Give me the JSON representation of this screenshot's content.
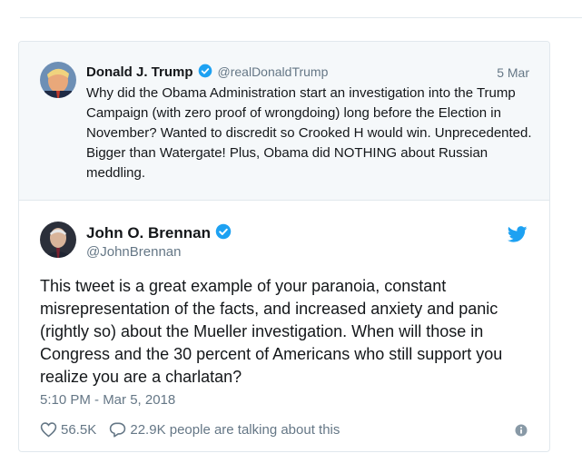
{
  "quoted": {
    "name": "Donald J. Trump",
    "handle": "@realDonaldTrump",
    "date": "5 Mar",
    "text": "Why did the Obama Administration start an investigation into the Trump Campaign (with zero proof of wrongdoing) long before the Election in November? Wanted to discredit so Crooked H would win. Unprecedented. Bigger than Watergate! Plus, Obama did NOTHING about Russian meddling.",
    "verified_icon": "verified-badge-icon",
    "avatar_icon": "avatar"
  },
  "main": {
    "name": "John O. Brennan",
    "handle": "@JohnBrennan",
    "text": "This tweet is a great example of your paranoia, constant misrepresentation of the facts, and increased anxiety and panic (rightly so) about the Mueller investigation. When will those in Congress and the 30 percent of Americans who still support you realize you are a charlatan?",
    "timestamp": "5:10 PM - Mar 5, 2018",
    "likes": "56.5K",
    "talking": "22.9K people are talking about this",
    "verified_icon": "verified-badge-icon",
    "brand_icon": "twitter-bird-icon"
  },
  "colors": {
    "accent": "#1da1f2",
    "secondary_text": "#657786",
    "quoted_bg": "#f5f8fa",
    "border": "#e1e8ed"
  }
}
